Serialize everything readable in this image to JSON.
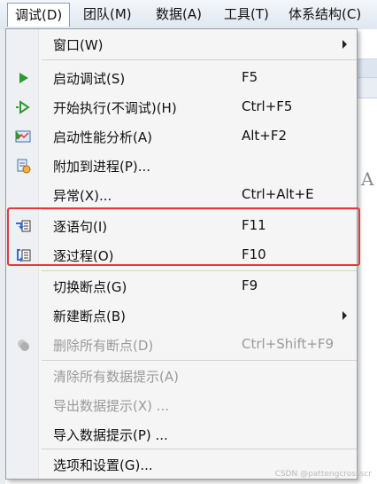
{
  "menubar": {
    "items": [
      {
        "label": "调试(D)"
      },
      {
        "label": "团队(M)"
      },
      {
        "label": "数据(A)"
      },
      {
        "label": "工具(T)"
      },
      {
        "label": "体系结构(C)"
      }
    ]
  },
  "menu": {
    "items": [
      {
        "label": "窗口(W)",
        "shortcut": ""
      },
      {
        "label": "启动调试(S)",
        "shortcut": "F5"
      },
      {
        "label": "开始执行(不调试)(H)",
        "shortcut": "Ctrl+F5"
      },
      {
        "label": "启动性能分析(A)",
        "shortcut": "Alt+F2"
      },
      {
        "label": "附加到进程(P)...",
        "shortcut": ""
      },
      {
        "label": "异常(X)...",
        "shortcut": "Ctrl+Alt+E"
      },
      {
        "label": "逐语句(I)",
        "shortcut": "F11"
      },
      {
        "label": "逐过程(O)",
        "shortcut": "F10"
      },
      {
        "label": "切换断点(G)",
        "shortcut": "F9"
      },
      {
        "label": "新建断点(B)",
        "shortcut": ""
      },
      {
        "label": "删除所有断点(D)",
        "shortcut": "Ctrl+Shift+F9"
      },
      {
        "label": "清除所有数据提示(A)",
        "shortcut": ""
      },
      {
        "label": "导出数据提示(X) ...",
        "shortcut": ""
      },
      {
        "label": "导入数据提示(P) ...",
        "shortcut": ""
      },
      {
        "label": "选项和设置(G)...",
        "shortcut": ""
      }
    ]
  },
  "background": {
    "partial_letter": "A"
  },
  "watermark": "CSDN @pattengcrossscr"
}
